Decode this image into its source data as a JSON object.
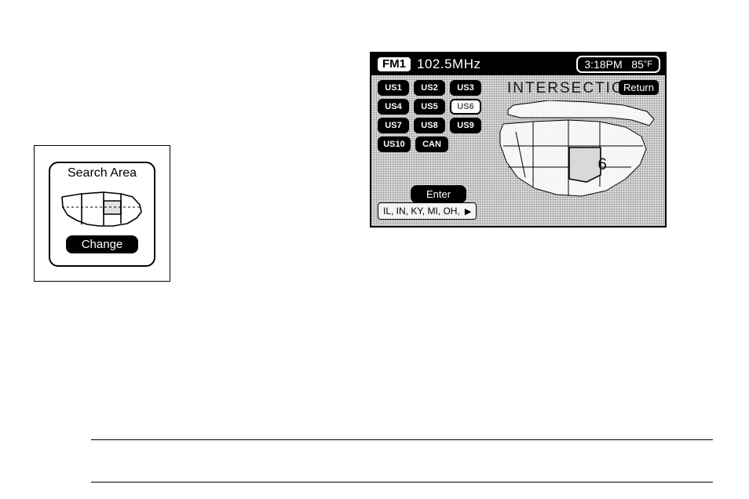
{
  "left_panel": {
    "title": "Search Area",
    "change_label": "Change"
  },
  "main_screen": {
    "status": {
      "band": "FM1",
      "frequency": "102.5MHz",
      "time": "3:18PM",
      "temp": "85",
      "temp_unit": "°F"
    },
    "title": "INTERSECTION",
    "return_label": "Return",
    "regions": [
      [
        "US1",
        "US2",
        "US3"
      ],
      [
        "US4",
        "US5",
        "US6"
      ],
      [
        "US7",
        "US8",
        "US9"
      ],
      [
        "US10",
        "CAN"
      ]
    ],
    "selected_region": "US6",
    "enter_label": "Enter",
    "state_strip": "IL, IN, KY, MI, OH,",
    "map_label": "6"
  }
}
